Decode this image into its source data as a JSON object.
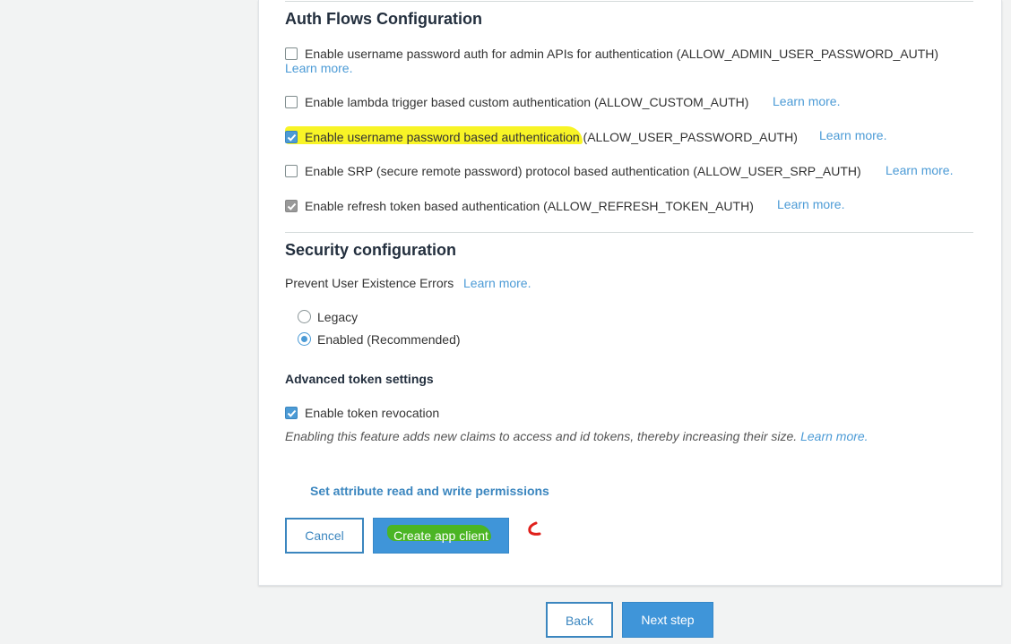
{
  "auth_flows": {
    "title": "Auth Flows Configuration",
    "items": [
      {
        "label": "Enable username password auth for admin APIs for authentication (ALLOW_ADMIN_USER_PASSWORD_AUTH)",
        "link": "Learn more.",
        "checked": false
      },
      {
        "label": "Enable lambda trigger based custom authentication (ALLOW_CUSTOM_AUTH)",
        "link": "Learn more.",
        "checked": false
      },
      {
        "label": "Enable username password based authentication (ALLOW_USER_PASSWORD_AUTH)",
        "link": "Learn more.",
        "checked": true
      },
      {
        "label": "Enable SRP (secure remote password) protocol based authentication (ALLOW_USER_SRP_AUTH)",
        "link": "Learn more.",
        "checked": false
      },
      {
        "label": "Enable refresh token based authentication (ALLOW_REFRESH_TOKEN_AUTH)",
        "link": "Learn more.",
        "checked": true,
        "disabled": true
      }
    ]
  },
  "security": {
    "title": "Security configuration",
    "prevent_label": "Prevent User Existence Errors",
    "prevent_link": "Learn more.",
    "options": [
      {
        "label": "Legacy",
        "selected": false
      },
      {
        "label": "Enabled (Recommended)",
        "selected": true
      }
    ]
  },
  "advanced": {
    "title": "Advanced token settings",
    "revocation_label": "Enable token revocation",
    "revocation_checked": true,
    "description": "Enabling this feature adds new claims to access and id tokens, thereby increasing their size.",
    "description_link": "Learn more."
  },
  "permissions_link": "Set attribute read and write permissions",
  "buttons": {
    "cancel": "Cancel",
    "create": "Create app client",
    "back": "Back",
    "next": "Next step"
  },
  "colors": {
    "accent": "#3f95d9",
    "link": "#4c9bd6",
    "highlight_yellow": "#f7f200",
    "highlight_green": "#4db80f",
    "annotation_red": "#e0201b"
  }
}
